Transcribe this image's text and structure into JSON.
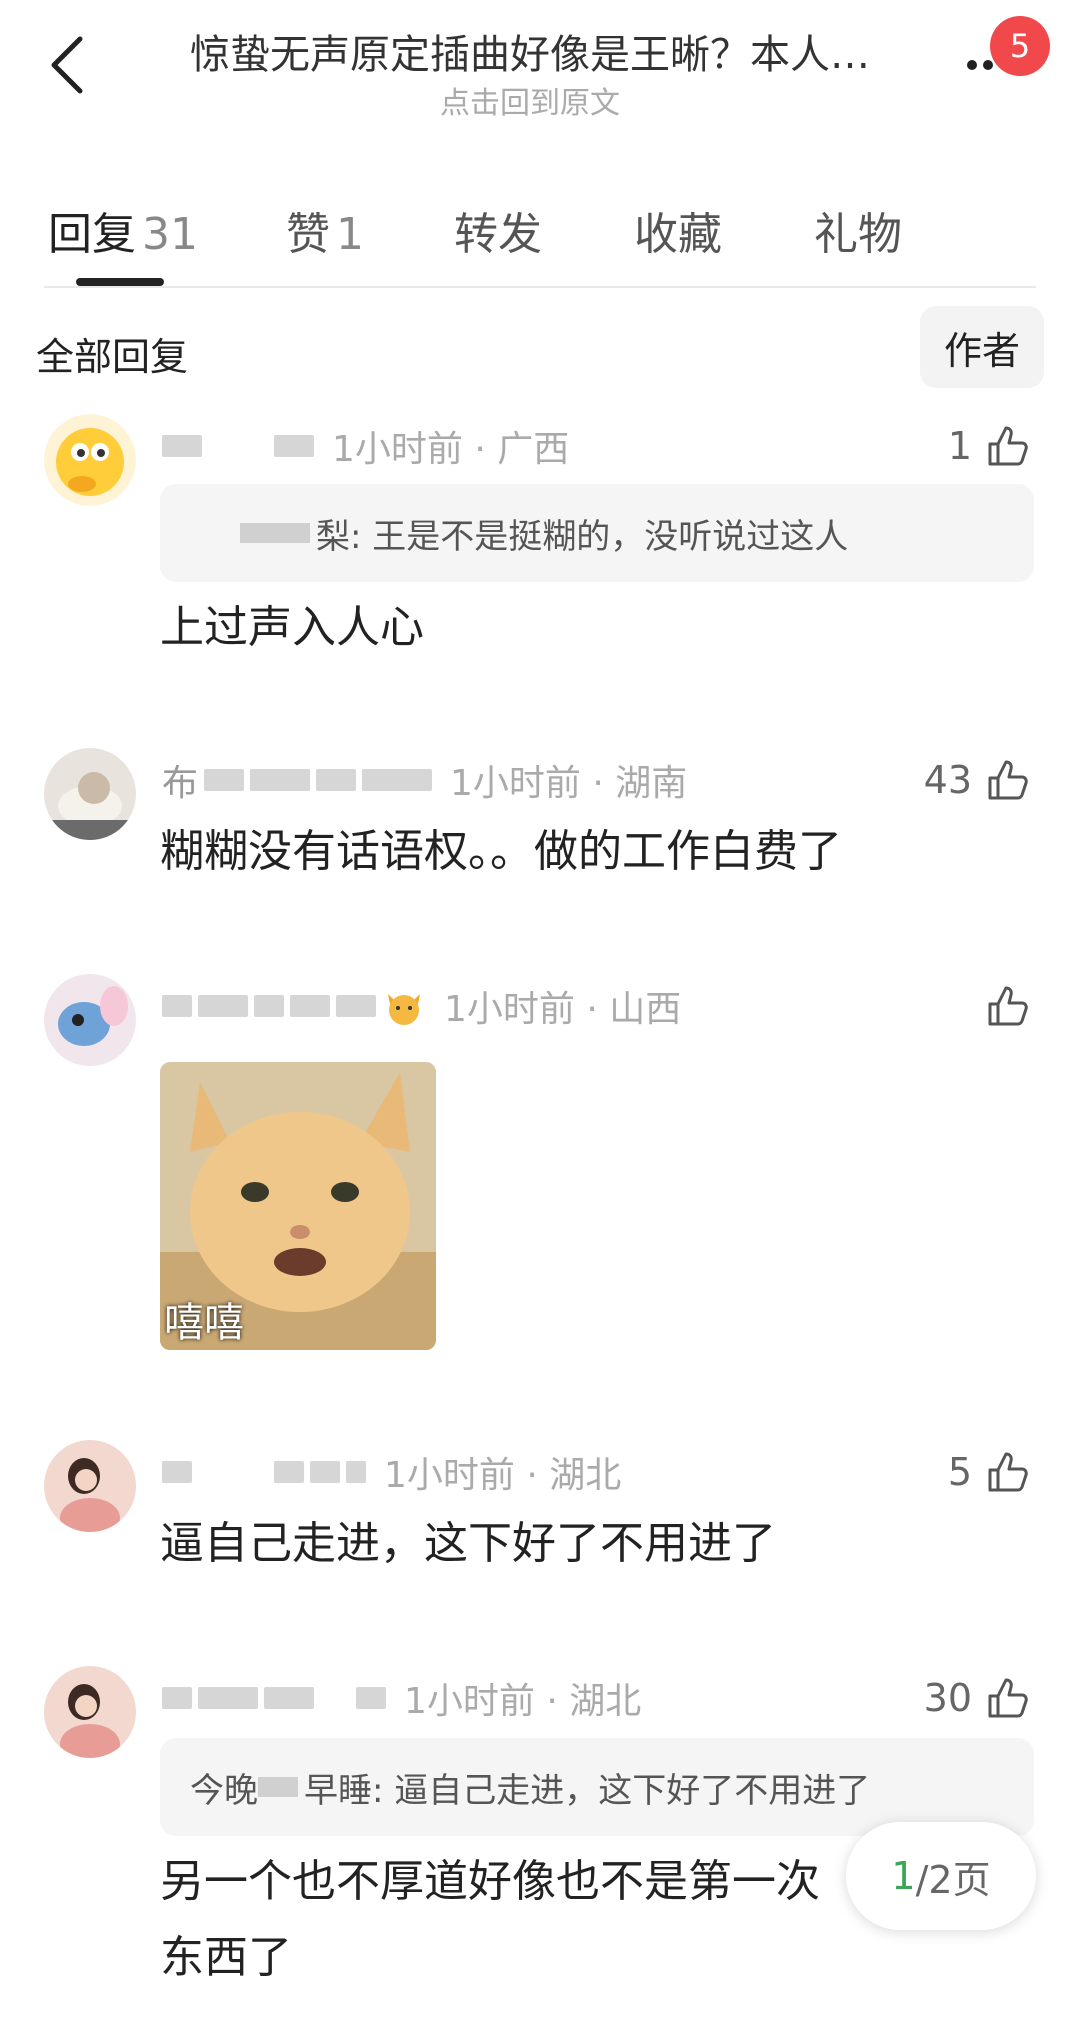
{
  "header": {
    "title": "惊蛰无声原定插曲好像是王晰？本人…",
    "subtitle": "点击回到原文",
    "badge": "5"
  },
  "tabs": [
    {
      "label": "回复",
      "count": "31"
    },
    {
      "label": "赞",
      "count": "1"
    },
    {
      "label": "转发",
      "count": ""
    },
    {
      "label": "收藏",
      "count": ""
    },
    {
      "label": "礼物",
      "count": ""
    }
  ],
  "filter": {
    "label": "全部回复",
    "author_button": "作者"
  },
  "comments": [
    {
      "name_visible": "",
      "time_location": "1小时前 · 广西",
      "likes": "1",
      "quote_name": "梨",
      "quote_text": ": 王是不是挺糊的，没听说过这人",
      "text": "上过声入人心"
    },
    {
      "name_visible": "布",
      "time_location": "1小时前 · 湖南",
      "likes": "43",
      "text": "糊糊没有话语权。。做的工作白费了"
    },
    {
      "name_visible": "",
      "time_location": "1小时前 · 山西",
      "likes": "",
      "sticker_text": "嘻嘻"
    },
    {
      "name_visible": "",
      "time_location": "1小时前 · 湖北",
      "likes": "5",
      "text": "逼自己走进，这下好了不用进了"
    },
    {
      "name_visible": "",
      "time_location": "1小时前 · 湖北",
      "likes": "30",
      "quote_name": "今晚",
      "quote_name2": "早睡",
      "quote_text": ": 逼自己走进，这下好了不用进了",
      "text_line1": "另一个也不厚道好像也不是第一次",
      "text_line2": "东西了"
    }
  ],
  "pager": {
    "current": "1",
    "total": "/2页"
  },
  "colors": {
    "badge": "#f0484b",
    "pager_current": "#3aa757"
  }
}
